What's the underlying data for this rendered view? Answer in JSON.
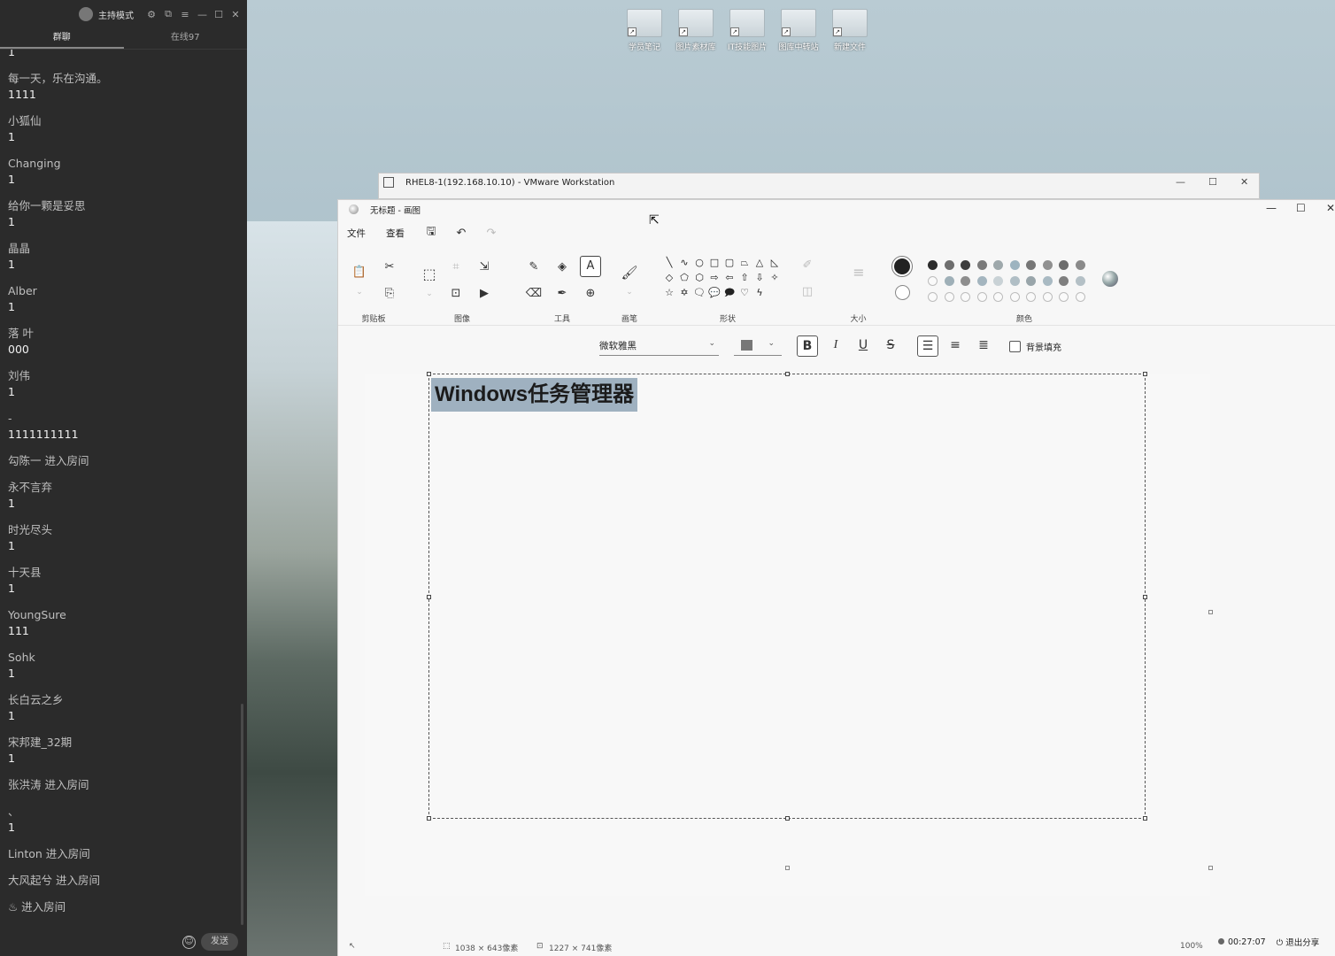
{
  "chat": {
    "host_label": "主持模式",
    "tabs": [
      "群聊",
      "在线97"
    ],
    "messages": [
      {
        "name": "",
        "text": "1"
      },
      {
        "name": "每一天，乐在沟通。",
        "text": "1111"
      },
      {
        "name": "小狐仙",
        "text": "1"
      },
      {
        "name": "Changing",
        "text": "1"
      },
      {
        "name": "给你一颗是妥思",
        "text": "1"
      },
      {
        "name": "晶晶",
        "text": "1"
      },
      {
        "name": "Alber",
        "text": "1"
      },
      {
        "name": "   落    叶",
        "text": "000"
      },
      {
        "name": "刘伟",
        "text": "1"
      },
      {
        "name": "-",
        "text": "1111111111"
      },
      {
        "name": "勾陈一 进入房间",
        "text": ""
      },
      {
        "name": "永不言弃",
        "text": "1"
      },
      {
        "name": "时光尽头",
        "text": "1"
      },
      {
        "name": "十天县",
        "text": "1"
      },
      {
        "name": "YoungSure",
        "text": "111"
      },
      {
        "name": "Sohk",
        "text": "1"
      },
      {
        "name": "长白云之乡",
        "text": "1"
      },
      {
        "name": "宋邦建_32期",
        "text": "1"
      },
      {
        "name": "张洪涛 进入房间",
        "text": ""
      },
      {
        "name": "、",
        "text": "1"
      },
      {
        "name": "Linton 进入房间",
        "text": ""
      },
      {
        "name": "大风起兮 进入房间",
        "text": ""
      },
      {
        "name": "♨ 进入房间",
        "text": ""
      }
    ],
    "send_label": "发送"
  },
  "desktop_icons": [
    "学员笔记",
    "图片素材库",
    "IT技能图片",
    "图库中转站",
    "新建文件"
  ],
  "vmware": {
    "title": "RHEL8-1(192.168.10.10) - VMware Workstation"
  },
  "paint": {
    "title": "无标题 - 画图",
    "menus": [
      "文件",
      "查看"
    ],
    "groups": {
      "clipboard": "剪贴板",
      "image": "图像",
      "tools": "工具",
      "brushes": "画笔",
      "shapes": "形状",
      "size": "大小",
      "colors": "颜色"
    },
    "text_toolbar": {
      "font": "微软雅黑",
      "bold": "B",
      "italic": "I",
      "underline": "U",
      "strike": "S",
      "background_fill": "背景填充"
    },
    "canvas_text": "Windows任务管理器",
    "status": {
      "selection_size": "1038 × 643像素",
      "canvas_size": "1227 × 741像素",
      "zoom": "100%"
    }
  },
  "recording": {
    "time": "00:27:07",
    "exit_label": "退出分享"
  },
  "colors": {
    "palette_row1": [
      "#2b2b2b",
      "#6e6e6e",
      "#3d3d3d",
      "#7a7a7a",
      "#9ea8ab",
      "#9db4c0",
      "#767676",
      "#909090",
      "#6c6c6c",
      "#8a8a8a"
    ],
    "palette_row2": [
      "#fafafa",
      "#9fb0b8",
      "#8e8e8e",
      "#a4b5bf",
      "#c9d2d6",
      "#b0bec5",
      "#99a5aa",
      "#a9bac3",
      "#7f7f7f",
      "#b4c0c6"
    ]
  }
}
